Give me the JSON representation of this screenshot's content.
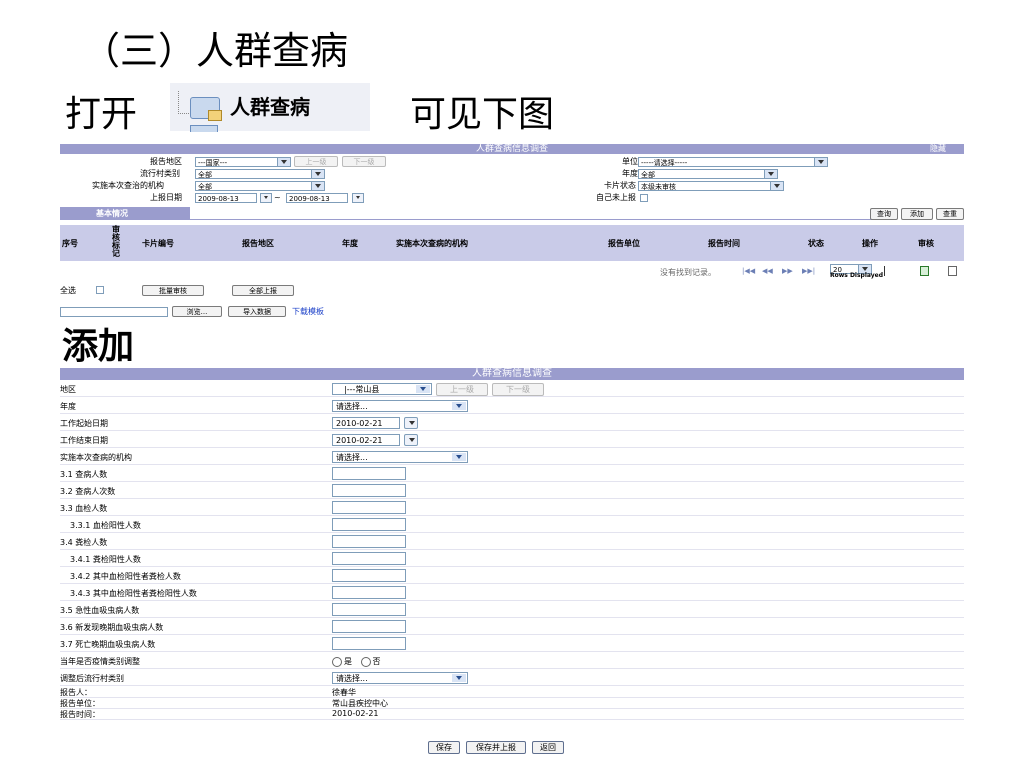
{
  "slide": {
    "section_title": "（三）人群查病",
    "open_prefix": "打开",
    "menu_item": "人群查病",
    "see_below": "可见下图",
    "add_title": "添加"
  },
  "list": {
    "header_title": "人群查病信息调查",
    "hide_label": "隐藏",
    "region_label": "报告地区",
    "region_value": "---国家---",
    "prev_level": "上一级",
    "next_level": "下一级",
    "unit_label": "单位",
    "unit_value": "-----请选择-----",
    "village_type_label": "流行村类别",
    "village_type_value": "全部",
    "year_label": "年度",
    "year_value": "全部",
    "agency_label": "实施本次查治的机构",
    "agency_value": "全部",
    "card_status_label": "卡片状态",
    "card_status_value": "本级未审核",
    "date_label": "上报日期",
    "date_from": "2009-08-13",
    "date_sep": "~",
    "date_to": "2009-08-13",
    "self_report_label": "自己未上报",
    "basic_tab": "基本情况",
    "query_btn": "查询",
    "add_btn": "添加",
    "reset_btn": "查重",
    "columns": [
      "序号",
      "审核标记",
      "卡片编号",
      "报告地区",
      "年度",
      "实施本次查病的机构",
      "报告单位",
      "报告时间",
      "状态",
      "操作",
      "审核"
    ],
    "no_records": "没有找到记录。",
    "page_size": "20",
    "rows_displayed": "Rows Displayed",
    "select_all": "全选",
    "batch_review": "批量审核",
    "report_all": "全部上报",
    "browse_btn": "浏览...",
    "import_btn": "导入数据",
    "download_template": "下载模板"
  },
  "form": {
    "header_title": "人群查病信息调查",
    "rows": [
      {
        "label": "地区",
        "type": "region",
        "value": "|---常山县",
        "prev": "上一级",
        "next": "下一级"
      },
      {
        "label": "年度",
        "type": "select",
        "value": "请选择..."
      },
      {
        "label": "工作起始日期",
        "type": "date",
        "value": "2010-02-21"
      },
      {
        "label": "工作结束日期",
        "type": "date",
        "value": "2010-02-21"
      },
      {
        "label": "实施本次查病的机构",
        "type": "select",
        "value": "请选择..."
      },
      {
        "label": "3.1 查病人数",
        "type": "input"
      },
      {
        "label": "3.2 查病人次数",
        "type": "input"
      },
      {
        "label": "3.3 血检人数",
        "type": "input"
      },
      {
        "label": "3.3.1 血检阳性人数",
        "type": "input",
        "indent": true
      },
      {
        "label": "3.4 粪检人数",
        "type": "input"
      },
      {
        "label": "3.4.1 粪检阳性人数",
        "type": "input",
        "indent": true
      },
      {
        "label": "3.4.2 其中血检阳性者粪检人数",
        "type": "input",
        "indent": true
      },
      {
        "label": "3.4.3 其中血检阳性者粪检阳性人数",
        "type": "input",
        "indent": true
      },
      {
        "label": "3.5 急性血吸虫病人数",
        "type": "input"
      },
      {
        "label": "3.6 新发现晚期血吸虫病人数",
        "type": "input"
      },
      {
        "label": "3.7 死亡晚期血吸虫病人数",
        "type": "input"
      },
      {
        "label": "当年是否疫情类别调整",
        "type": "radio",
        "yes": "是",
        "no": "否"
      },
      {
        "label": "调整后流行村类别",
        "type": "select",
        "value": "请选择..."
      }
    ],
    "reporter_label": "报告人：",
    "reporter_value": "徐春华",
    "report_unit_label": "报告单位：",
    "report_unit_value": "常山县疾控中心",
    "report_time_label": "报告时间：",
    "report_time_value": "2010-02-21",
    "save_btn": "保存",
    "save_report_btn": "保存并上报",
    "back_btn": "返回"
  }
}
